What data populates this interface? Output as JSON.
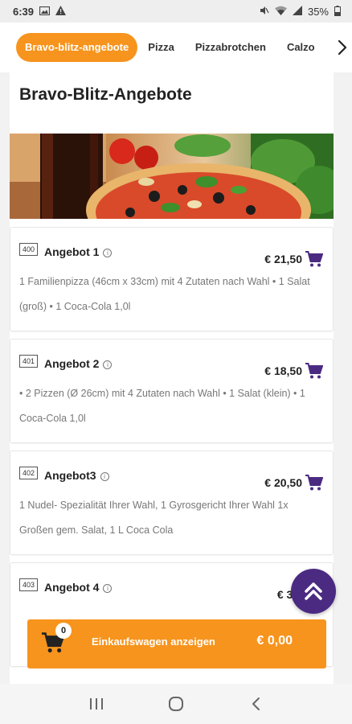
{
  "status": {
    "time": "6:39",
    "battery": "35%"
  },
  "tabs": [
    {
      "label": "Bravo-blitz-angebote",
      "active": true
    },
    {
      "label": "Pizza",
      "active": false
    },
    {
      "label": "Pizzabrotchen",
      "active": false
    },
    {
      "label": "Calzo",
      "active": false
    }
  ],
  "section": {
    "title": "Bravo-Blitz-Angebote"
  },
  "items": [
    {
      "number": "400",
      "name": "Angebot 1",
      "price": "€ 21,50",
      "description": "1 Familienpizza (46cm x 33cm) mit 4 Zutaten nach Wahl • 1 Salat (groß) • 1 Coca-Cola 1,0l"
    },
    {
      "number": "401",
      "name": "Angebot 2",
      "price": "€ 18,50",
      "description": "• 2 Pizzen (Ø 26cm) mit 4 Zutaten nach Wahl • 1 Salat (klein) • 1 Coca-Cola 1,0l"
    },
    {
      "number": "402",
      "name": "Angebot3",
      "price": "€ 20,50",
      "description": "1 Nudel- Spezialität Ihrer Wahl, 1 Gyrosgericht Ihrer Wahl 1x Großen gem. Salat, 1 L Coca Cola"
    },
    {
      "number": "403",
      "name": "Angebot 4",
      "price": "€ 36,",
      "description": ""
    }
  ],
  "cart": {
    "count": "0",
    "label": "Einkaufswagen anzeigen",
    "total": "€ 0,00"
  },
  "colors": {
    "accent": "#f7941d",
    "purple": "#4b2a82"
  }
}
